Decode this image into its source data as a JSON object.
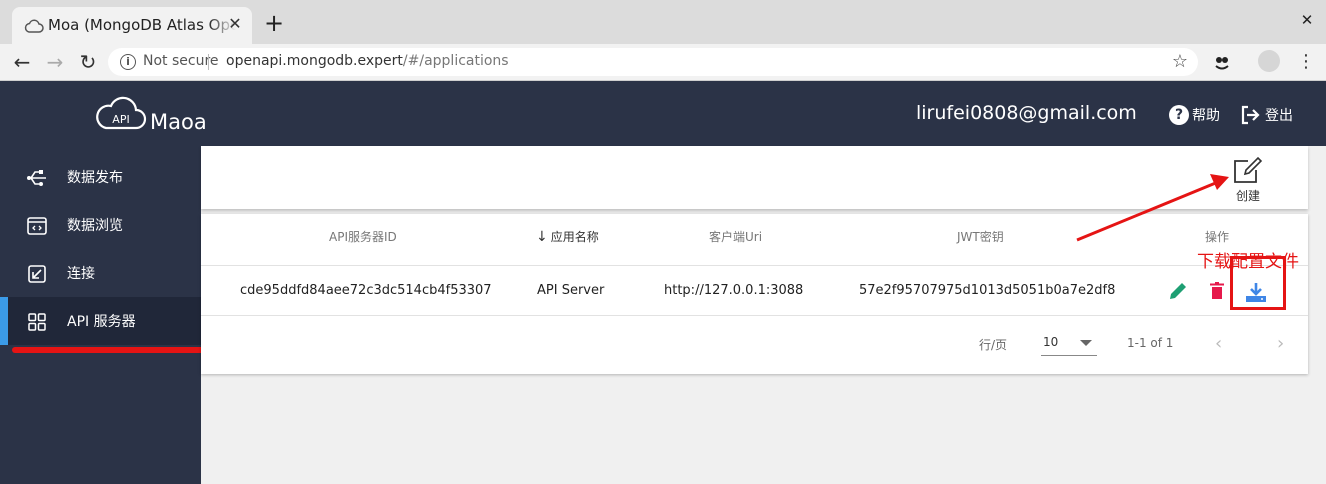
{
  "browser": {
    "tab_title": "Moa (MongoDB Atlas Open API)",
    "tab_close": "✕",
    "new_tab": "+",
    "window_close": "✕",
    "nav_back": "←",
    "nav_forward": "→",
    "nav_reload": "↻",
    "not_secure": "Not secure",
    "url_host": "openapi.mongodb.expert",
    "url_rest": "/#/applications",
    "star": "☆",
    "menu": "⋮"
  },
  "header": {
    "brand": "Maoa",
    "logo_text": "API",
    "user_email": "lirufei0808@gmail.com",
    "help_label": "帮助",
    "logout_label": "登出"
  },
  "sidebar": {
    "items": [
      {
        "label": "数据发布",
        "icon": "usb-icon"
      },
      {
        "label": "数据浏览",
        "icon": "browser-code-icon"
      },
      {
        "label": "连接",
        "icon": "link-icon"
      },
      {
        "label": "API 服务器",
        "icon": "grid-icon",
        "active": true
      }
    ]
  },
  "toolbar": {
    "create_label": "创建"
  },
  "table": {
    "columns": [
      "API服务器ID",
      "应用名称",
      "客户端Uri",
      "JWT密钥",
      "操作"
    ],
    "sort_arrow": "↓",
    "rows": [
      {
        "id": "cde95ddfd84aee72c3dc514cb4f53307",
        "name": "API Server",
        "client_uri": "http://127.0.0.1:3088",
        "jwt_secret": "57e2f95707975d1013d5051b0a7e2df8"
      }
    ]
  },
  "pagination": {
    "rows_per_page_label": "行/页",
    "rows_per_page": "10",
    "range": "1-1 of 1",
    "prev": "‹",
    "next": "›"
  },
  "annotation": {
    "download_note": "下载配置文件"
  },
  "colors": {
    "header_bg": "#2b3347",
    "accent_blue": "#3b9be8",
    "edit_green": "#1e9f73",
    "delete_red": "#e6194b",
    "download_blue": "#3f86e6",
    "annotation_red": "#e51414"
  }
}
